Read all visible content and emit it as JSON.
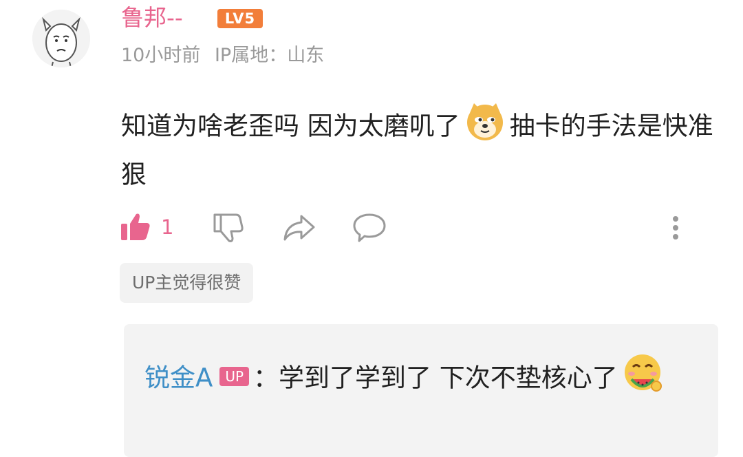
{
  "comment": {
    "username": "鲁邦--",
    "level": "LV5",
    "time": "10小时前",
    "ip_location": "IP属地：山东",
    "text_part1": "知道为啥老歪吗 因为太磨叽了",
    "text_emoji": "doge-emoji",
    "text_part2": "抽卡的手法是快准狠",
    "like_count": "1",
    "up_badge": "UP主觉得很赞"
  },
  "reply": {
    "username": "锐金A",
    "up_tag": "UP",
    "colon": "：",
    "text": "学到了学到了 下次不垫核心了",
    "emoji": "watermelon-eating-emoji"
  },
  "colors": {
    "username": "#e8658e",
    "level_badge": "#f27e3a",
    "reply_username": "#3f8fc7",
    "like_active": "#e8658e",
    "icon_gray": "#9a9a9a"
  },
  "icons": [
    "thumbs-up-icon",
    "thumbs-down-icon",
    "share-icon",
    "comment-icon",
    "more-icon"
  ]
}
